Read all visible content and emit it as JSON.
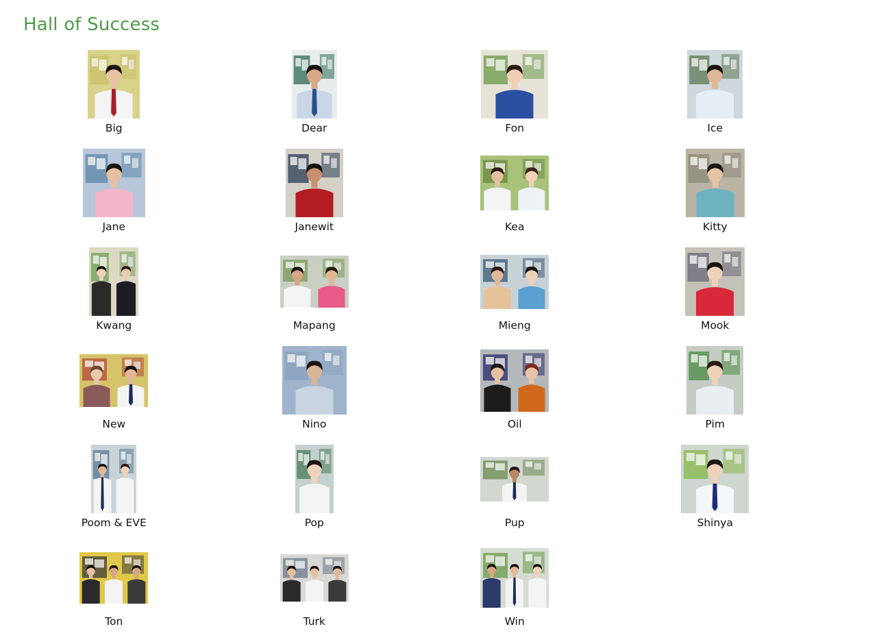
{
  "page": {
    "title": "Hall of Success",
    "title_color": "#4e9a4a"
  },
  "gallery": [
    {
      "name": "Big",
      "w": 76,
      "h": 100,
      "bg": "#d9d28a",
      "wall": "#c9c06a",
      "people": [
        {
          "shirt": "#f4f4f4",
          "tie": "#a31f2a",
          "skin": "#e8c4a4",
          "hair": "#1a1410"
        }
      ]
    },
    {
      "name": "Dear",
      "w": 66,
      "h": 100,
      "bg": "#e8ecec",
      "wall": "#2d6b5a",
      "people": [
        {
          "shirt": "#c9d6e8",
          "tie": "#2a4f8a",
          "skin": "#d8a888",
          "hair": "#1a1410"
        }
      ]
    },
    {
      "name": "Fon",
      "w": 98,
      "h": 100,
      "bg": "#e7e2d6",
      "wall": "#6a9a48",
      "people": [
        {
          "shirt": "#2a4fa0",
          "tie": "",
          "skin": "#f0cfb6",
          "hair": "#2b1a12"
        }
      ]
    },
    {
      "name": "Ice",
      "w": 81,
      "h": 100,
      "bg": "#cfd8dc",
      "wall": "#5c7a54",
      "people": [
        {
          "shirt": "#e6eef6",
          "tie": "",
          "skin": "#e0b898",
          "hair": "#1a1410"
        }
      ]
    },
    {
      "name": "Jane",
      "w": 91,
      "h": 100,
      "bg": "#b7c7d9",
      "wall": "#5c86a8",
      "people": [
        {
          "shirt": "#f2b6c8",
          "tie": "",
          "skin": "#e6c0a2",
          "hair": "#1a1410"
        }
      ]
    },
    {
      "name": "Janewit",
      "w": 84,
      "h": 100,
      "bg": "#d4d0c8",
      "wall": "#2a3c54",
      "people": [
        {
          "shirt": "#b31d22",
          "tie": "",
          "skin": "#c99070",
          "hair": "#15100c"
        }
      ]
    },
    {
      "name": "Kea",
      "w": 100,
      "h": 80,
      "bg": "#a8c27a",
      "wall": "#6a8a40",
      "people": [
        {
          "shirt": "#f4f4f4",
          "tie": "",
          "skin": "#e6c0a2",
          "hair": "#2b1a12"
        },
        {
          "shirt": "#eef2f6",
          "tie": "",
          "skin": "#f0d2ba",
          "hair": "#3a2416"
        }
      ]
    },
    {
      "name": "Kitty",
      "w": 86,
      "h": 100,
      "bg": "#b9b4a4",
      "wall": "#8c8878",
      "people": [
        {
          "shirt": "#6fb3c2",
          "tie": "",
          "skin": "#e8c4a6",
          "hair": "#1a1410"
        }
      ]
    },
    {
      "name": "Kwang",
      "w": 72,
      "h": 100,
      "bg": "#dcd8c4",
      "wall": "#72a05a",
      "people": [
        {
          "shirt": "#2a2a2a",
          "tie": "",
          "skin": "#f0d2ba",
          "hair": "#1a1410"
        },
        {
          "shirt": "#1c1c24",
          "tie": "",
          "skin": "#eccbb0",
          "hair": "#2b1a12"
        }
      ]
    },
    {
      "name": "Mapang",
      "w": 100,
      "h": 76,
      "bg": "#c9cfc2",
      "wall": "#7a9a5a",
      "people": [
        {
          "shirt": "#f4f4f4",
          "tie": "",
          "skin": "#d6a686",
          "hair": "#1a1410"
        },
        {
          "shirt": "#e85a8a",
          "tie": "",
          "skin": "#e0b898",
          "hair": "#2b1a12"
        }
      ]
    },
    {
      "name": "Mieng",
      "w": 100,
      "h": 79,
      "bg": "#c8d2d6",
      "wall": "#3c5a78",
      "people": [
        {
          "shirt": "#e6c29a",
          "tie": "",
          "skin": "#e0b898",
          "hair": "#2b1a12"
        },
        {
          "shirt": "#5aa0d0",
          "tie": "",
          "skin": "#f0d2ba",
          "hair": "#1a1410"
        }
      ]
    },
    {
      "name": "Mook",
      "w": 87,
      "h": 100,
      "bg": "#c4c2b8",
      "wall": "#6a6878",
      "people": [
        {
          "shirt": "#d8283a",
          "tie": "",
          "skin": "#f0d2ba",
          "hair": "#1a1410"
        }
      ]
    },
    {
      "name": "New",
      "w": 100,
      "h": 77,
      "bg": "#d6c46a",
      "wall": "#b34a3a",
      "people": [
        {
          "shirt": "#8a5a5a",
          "tie": "",
          "skin": "#e8c8ae",
          "hair": "#6a4a2a"
        },
        {
          "shirt": "#f4f4f4",
          "tie": "#1c2c5a",
          "skin": "#e0b898",
          "hair": "#1a1410"
        }
      ]
    },
    {
      "name": "Nino",
      "w": 94,
      "h": 100,
      "bg": "#9fb3cc",
      "wall": "#8aa0bc",
      "people": [
        {
          "shirt": "#c8d4e0",
          "tie": "",
          "skin": "#d8b498",
          "hair": "#1a1410"
        }
      ]
    },
    {
      "name": "Oil",
      "w": 100,
      "h": 91,
      "bg": "#b4b8ba",
      "wall": "#2a2a6a",
      "people": [
        {
          "shirt": "#1c1c1c",
          "tie": "",
          "skin": "#e6c0a2",
          "hair": "#1a1410"
        },
        {
          "shirt": "#d0681a",
          "tie": "",
          "skin": "#e8c4a6",
          "hair": "#7a2a1a"
        }
      ]
    },
    {
      "name": "Pim",
      "w": 83,
      "h": 100,
      "bg": "#c4ccc4",
      "wall": "#4a8a46",
      "people": [
        {
          "shirt": "#e8eef2",
          "tie": "",
          "skin": "#f0d2ba",
          "hair": "#2b1a12"
        }
      ]
    },
    {
      "name": "Poom & EVE",
      "w": 66,
      "h": 100,
      "bg": "#c8d4d8",
      "wall": "#5a7a96",
      "people": [
        {
          "shirt": "#f4f4f4",
          "tie": "#1c2c5a",
          "skin": "#e0b898",
          "hair": "#1a1410"
        },
        {
          "shirt": "#f4f4f4",
          "tie": "",
          "skin": "#f0d2ba",
          "hair": "#2b1a12"
        }
      ]
    },
    {
      "name": "Pop",
      "w": 56,
      "h": 100,
      "bg": "#c4d0d0",
      "wall": "#4a7c5a",
      "people": [
        {
          "shirt": "#f4f4f4",
          "tie": "",
          "skin": "#f0d2ba",
          "hair": "#1a1410"
        }
      ]
    },
    {
      "name": "Pup",
      "w": 100,
      "h": 65,
      "bg": "#d2d8d0",
      "wall": "#6a8a52",
      "people": [
        {
          "shirt": "#f4f4f4",
          "tie": "#1c2c5a",
          "skin": "#b88868",
          "hair": "#1a1410"
        }
      ]
    },
    {
      "name": "Shinya",
      "w": 99,
      "h": 100,
      "bg": "#cfd6d0",
      "wall": "#86b84a",
      "people": [
        {
          "shirt": "#f4f6fa",
          "tie": "#1c2c7a",
          "skin": "#f0d2ba",
          "hair": "#1a1410"
        }
      ]
    },
    {
      "name": "Ton",
      "w": 100,
      "h": 75,
      "bg": "#e0c84a",
      "wall": "#3a3a3a",
      "people": [
        {
          "shirt": "#2a2a2a",
          "tie": "",
          "skin": "#e6c0a2",
          "hair": "#1a1410"
        },
        {
          "shirt": "#f4f4f4",
          "tie": "",
          "skin": "#d6a686",
          "hair": "#1a1410"
        },
        {
          "shirt": "#3a3a3a",
          "tie": "",
          "skin": "#d6a686",
          "hair": "#1a1410"
        }
      ]
    },
    {
      "name": "Turk",
      "w": 100,
      "h": 69,
      "bg": "#d8d8d4",
      "wall": "#6a7a8a",
      "people": [
        {
          "shirt": "#2a2a2a",
          "tie": "",
          "skin": "#e6c0a2",
          "hair": "#1a1410"
        },
        {
          "shirt": "#f4f4f4",
          "tie": "",
          "skin": "#e6c0a2",
          "hair": "#1a1410"
        },
        {
          "shirt": "#3a3a3a",
          "tie": "",
          "skin": "#e0b898",
          "hair": "#1a1410"
        }
      ]
    },
    {
      "name": "Win",
      "w": 100,
      "h": 87,
      "bg": "#d6dcd2",
      "wall": "#6a9a4a",
      "people": [
        {
          "shirt": "#2a3a6a",
          "tie": "",
          "skin": "#d6a686",
          "hair": "#1a1410"
        },
        {
          "shirt": "#f4f4f4",
          "tie": "#1c2c5a",
          "skin": "#e0b898",
          "hair": "#1a1410"
        },
        {
          "shirt": "#f4f4f4",
          "tie": "",
          "skin": "#f0d2ba",
          "hair": "#1a1410"
        }
      ]
    }
  ]
}
